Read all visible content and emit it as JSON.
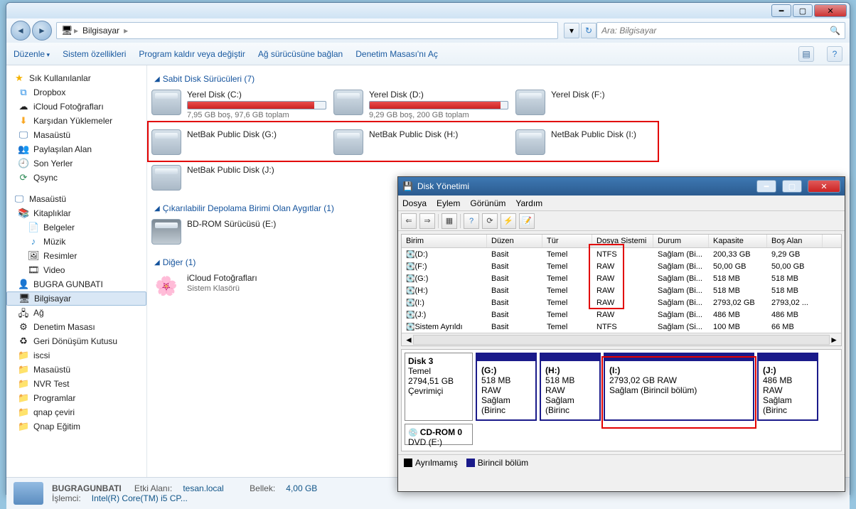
{
  "title_bar": {
    "icon": "🖥"
  },
  "breadcrumbs": [
    "Bilgisayar"
  ],
  "search_placeholder": "Ara: Bilgisayar",
  "toolbar": {
    "organize": "Düzenle",
    "sys_props": "Sistem özellikleri",
    "uninstall": "Program kaldır veya değiştir",
    "map_drive": "Ağ sürücüsüne bağlan",
    "control_panel": "Denetim Masası'nı Aç"
  },
  "sidebar": {
    "favorites": "Sık Kullanılanlar",
    "fav_items": [
      "Dropbox",
      "iCloud Fotoğrafları",
      "Karşıdan Yüklemeler",
      "Masaüstü",
      "Paylaşılan Alan",
      "Son Yerler",
      "Qsync"
    ],
    "desktop": "Masaüstü",
    "libs": "Kitaplıklar",
    "lib_items": [
      "Belgeler",
      "Müzik",
      "Resimler",
      "Video"
    ],
    "user": "BUGRA GUNBATI",
    "computer": "Bilgisayar",
    "network": "Ağ",
    "ctrl": "Denetim Masası",
    "recycle": "Geri Dönüşüm Kutusu",
    "folders": [
      "iscsi",
      "Masaüstü",
      "NVR Test",
      "Programlar",
      "qnap çeviri",
      "Qnap Eğitim"
    ]
  },
  "sections": {
    "hdd": "Sabit Disk Sürücüleri (7)",
    "removable": "Çıkarılabilir Depolama Birimi Olan Aygıtlar (1)",
    "other": "Diğer (1)"
  },
  "drives": {
    "c": {
      "name": "Yerel Disk (C:)",
      "sub": "7,95 GB boş, 97,6 GB toplam"
    },
    "d": {
      "name": "Yerel Disk (D:)",
      "sub": "9,29 GB boş, 200 GB toplam"
    },
    "f": {
      "name": "Yerel Disk (F:)"
    },
    "g": {
      "name": "NetBak Public Disk (G:)"
    },
    "h": {
      "name": "NetBak Public Disk (H:)"
    },
    "i": {
      "name": "NetBak Public Disk (I:)"
    },
    "j": {
      "name": "NetBak Public Disk (J:)"
    },
    "bd": {
      "name": "BD-ROM Sürücüsü (E:)"
    },
    "icloud": {
      "name": "iCloud Fotoğrafları",
      "sub": "Sistem Klasörü"
    }
  },
  "status": {
    "name": "BUGRAGUNBATI",
    "domain_lbl": "Etki Alanı:",
    "domain": "tesan.local",
    "mem_lbl": "Bellek:",
    "mem": "4,00 GB",
    "cpu_lbl": "İşlemci:",
    "cpu": "Intel(R) Core(TM) i5 CP..."
  },
  "diskmgmt": {
    "title": "Disk Yönetimi",
    "menu": [
      "Dosya",
      "Eylem",
      "Görünüm",
      "Yardım"
    ],
    "cols": [
      "Birim",
      "Düzen",
      "Tür",
      "Dosya Sistemi",
      "Durum",
      "Kapasite",
      "Boş Alan"
    ],
    "rows": [
      {
        "v": [
          "(D:)",
          "Basit",
          "Temel",
          "NTFS",
          "Sağlam (Bi...",
          "200,33 GB",
          "9,29 GB"
        ]
      },
      {
        "v": [
          "(F:)",
          "Basit",
          "Temel",
          "RAW",
          "Sağlam (Bi...",
          "50,00 GB",
          "50,00 GB"
        ]
      },
      {
        "v": [
          "(G:)",
          "Basit",
          "Temel",
          "RAW",
          "Sağlam (Bi...",
          "518 MB",
          "518 MB"
        ]
      },
      {
        "v": [
          "(H:)",
          "Basit",
          "Temel",
          "RAW",
          "Sağlam (Bi...",
          "518 MB",
          "518 MB"
        ]
      },
      {
        "v": [
          "(I:)",
          "Basit",
          "Temel",
          "RAW",
          "Sağlam (Bi...",
          "2793,02 GB",
          "2793,02 ..."
        ]
      },
      {
        "v": [
          "(J:)",
          "Basit",
          "Temel",
          "RAW",
          "Sağlam (Bi...",
          "486 MB",
          "486 MB"
        ]
      },
      {
        "v": [
          "Sistem Ayrıldı",
          "Basit",
          "Temel",
          "NTFS",
          "Sağlam (Si...",
          "100 MB",
          "66 MB"
        ]
      }
    ],
    "disk3": {
      "label": "Disk 3",
      "type": "Temel",
      "size": "2794,51 GB",
      "state": "Çevrimiçi"
    },
    "parts": [
      {
        "n": "(G:)",
        "s": "518 MB RAW",
        "st": "Sağlam (Birinc"
      },
      {
        "n": "(H:)",
        "s": "518 MB RAW",
        "st": "Sağlam (Birinc"
      },
      {
        "n": "(I:)",
        "s": "2793,02 GB RAW",
        "st": "Sağlam (Birincil bölüm)"
      },
      {
        "n": "(J:)",
        "s": "486 MB RAW",
        "st": "Sağlam (Birinc"
      }
    ],
    "cdrom": {
      "label": "CD-ROM 0",
      "type": "DVD (E:)"
    },
    "legend": {
      "unalloc": "Ayrılmamış",
      "primary": "Birincil bölüm"
    }
  }
}
